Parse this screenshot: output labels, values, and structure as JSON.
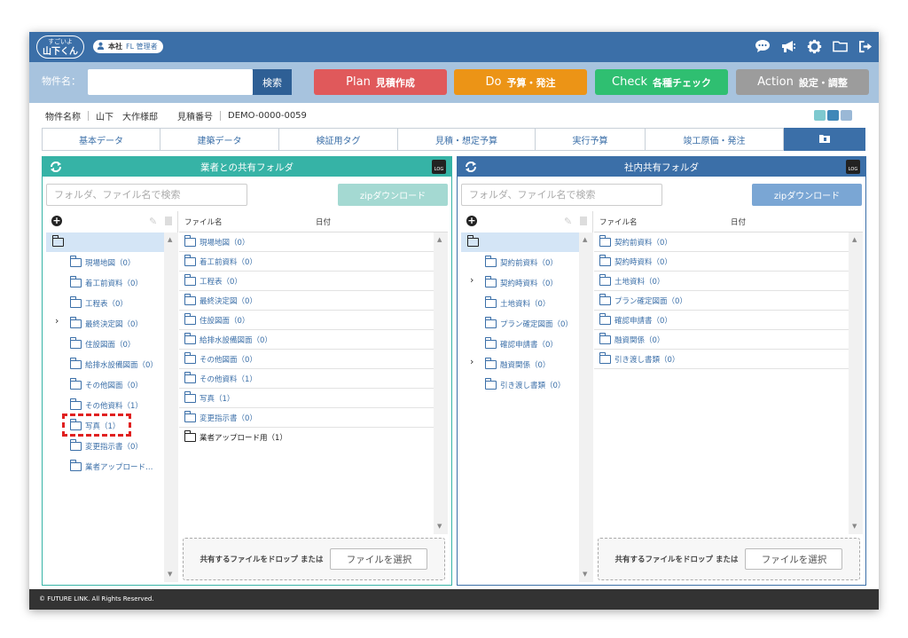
{
  "app": {
    "logo_top": "すごいよ",
    "logo_bottom": "山下くん",
    "branch_name": "本社",
    "branch_role": "FL 管理者"
  },
  "search": {
    "label": "物件名：",
    "value": "",
    "button": "検索"
  },
  "pdca": [
    {
      "en": "Plan",
      "jp": "見積作成",
      "color": "#e0595b"
    },
    {
      "en": "Do",
      "jp": "予算・発注",
      "color": "#ec9416"
    },
    {
      "en": "Check",
      "jp": "各種チェック",
      "color": "#2fbf71"
    },
    {
      "en": "Action",
      "jp": "設定・調整",
      "color": "#9c9c9c"
    }
  ],
  "info": {
    "name_label": "物件名称",
    "name_value": "山下　大作様邸",
    "no_label": "見積番号",
    "no_value": "DEMO-0000-0059"
  },
  "view_colors": [
    "#7ec9cf",
    "#3f87b8",
    "#9ab8d6"
  ],
  "tabs": [
    "基本データ",
    "建築データ",
    "検証用タグ",
    "見積・想定予算",
    "実行予算",
    "竣工原価・発注"
  ],
  "left_panel": {
    "title": "業者との共有フォルダ",
    "color": "#36b3a6",
    "search_placeholder": "フォルダ、ファイル名で検索",
    "zip": "zipダウンロード",
    "zip_color": "#a4d9d2",
    "tree": [
      "現場地図（0）",
      "着工前資料（0）",
      "工程表（0）",
      "最終決定図（0）",
      "住設図面（0）",
      "給排水設備図面（0）",
      "その他図面（0）",
      "その他資料（1）",
      "写真（1）",
      "変更指示書（0）",
      "業者アップロード…"
    ],
    "files": [
      "現場地図（0）",
      "着工前資料（0）",
      "工程表（0）",
      "最終決定図（0）",
      "住設図面（0）",
      "給排水設備図面（0）",
      "その他図面（0）",
      "その他資料（1）",
      "写真（1）",
      "変更指示書（0）",
      "業者アップロード用（1）"
    ]
  },
  "right_panel": {
    "title": "社内共有フォルダ",
    "color": "#3b6fa8",
    "search_placeholder": "フォルダ、ファイル名で検索",
    "zip": "zipダウンロード",
    "zip_color": "#7aa6d4",
    "tree": [
      "契約前資料（0）",
      "契約時資料（0）",
      "土地資料（0）",
      "プラン確定図面（0）",
      "確認申請書（0）",
      "融資関係（0）",
      "引き渡し書類（0）"
    ],
    "files": [
      "契約前資料（0）",
      "契約時資料（0）",
      "土地資料（0）",
      "プラン確定図面（0）",
      "確認申請書（0）",
      "融資関係（0）",
      "引き渡し書類（0）"
    ]
  },
  "common": {
    "col_name": "ファイル名",
    "col_date": "日付",
    "drop_text": "共有するファイルをドロップ または",
    "select_button": "ファイルを選択",
    "log": "LOG"
  },
  "footer": "© FUTURE LINK. All Rights Reserved."
}
